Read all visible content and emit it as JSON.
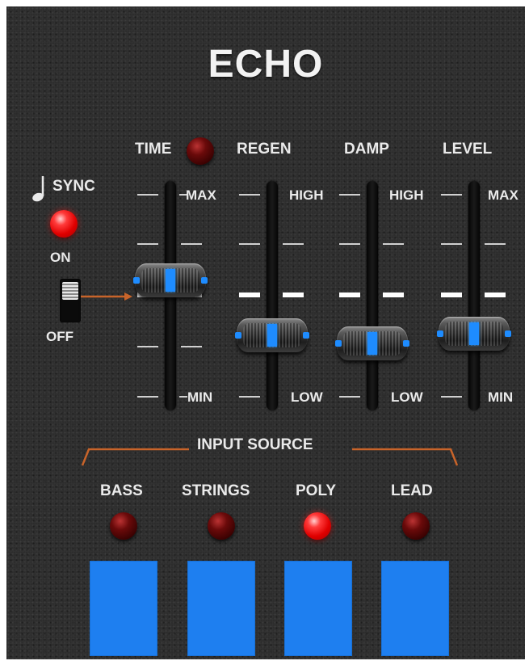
{
  "module": {
    "title": "ECHO",
    "sync": {
      "label": "SYNC",
      "note_icon": "quarter-note-icon",
      "led_on": true,
      "switch_on_label": "ON",
      "switch_off_label": "OFF"
    },
    "sliders": [
      {
        "label": "TIME",
        "top_label": "MAX",
        "bottom_label": "MIN",
        "value": 0.55,
        "has_led": true
      },
      {
        "label": "REGEN",
        "top_label": "HIGH",
        "bottom_label": "LOW",
        "value": 0.33
      },
      {
        "label": "DAMP",
        "top_label": "HIGH",
        "bottom_label": "LOW",
        "value": 0.29
      },
      {
        "label": "LEVEL",
        "top_label": "MAX",
        "bottom_label": "MIN",
        "value": 0.34
      }
    ],
    "input_source": {
      "label": "INPUT SOURCE",
      "items": [
        {
          "label": "BASS",
          "active": false
        },
        {
          "label": "STRINGS",
          "active": false
        },
        {
          "label": "POLY",
          "active": true
        },
        {
          "label": "LEAD",
          "active": false
        }
      ]
    },
    "colors": {
      "accent_blue": "#1e7ff0",
      "led_red": "#ff2a2a",
      "orange_line": "#c8642a"
    }
  }
}
